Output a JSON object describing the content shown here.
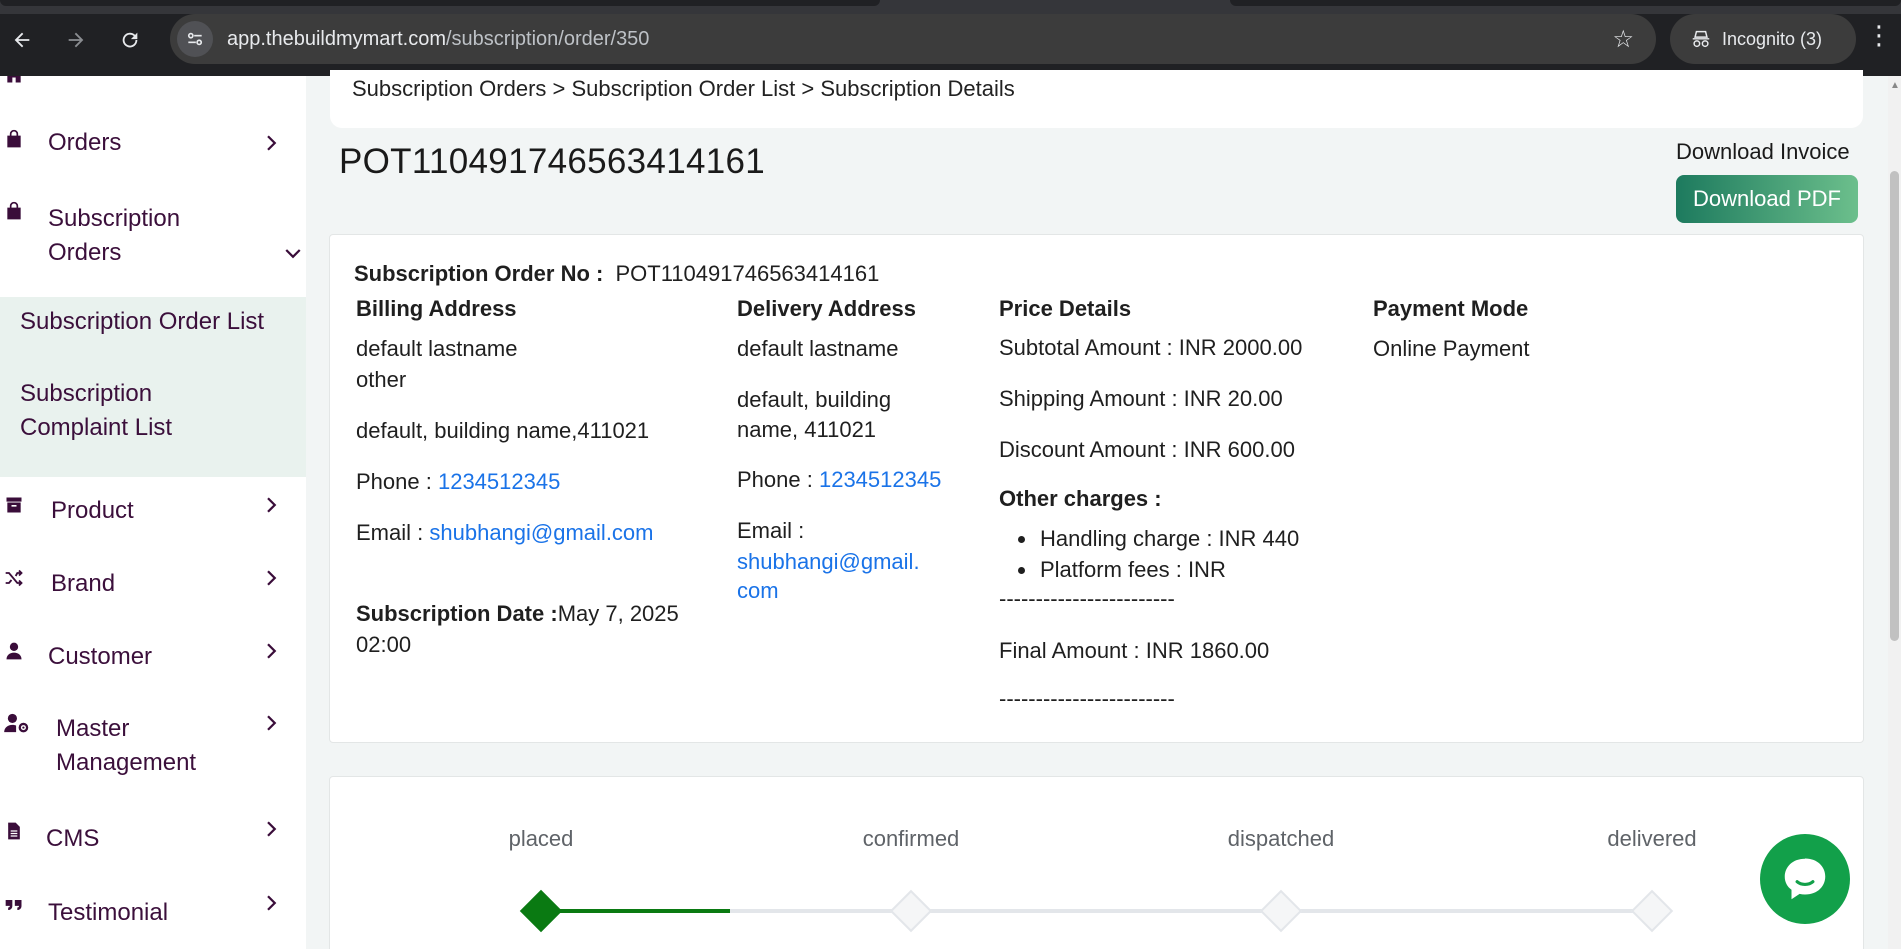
{
  "browser": {
    "url_host": "app.thebuildmymart.com",
    "url_path": "/subscription/order/350",
    "incognito_label": "Incognito (3)"
  },
  "sidebar": {
    "items": [
      {
        "label": "Orders",
        "icon": "bag-icon"
      },
      {
        "label": "Subscription Orders",
        "icon": "bag-icon"
      },
      {
        "label": "Product",
        "icon": "archive-icon"
      },
      {
        "label": "Brand",
        "icon": "shuffle-icon"
      },
      {
        "label": "Customer",
        "icon": "user-icon"
      },
      {
        "label": "Master Management",
        "icon": "user-gear-icon"
      },
      {
        "label": "CMS",
        "icon": "file-icon"
      },
      {
        "label": "Testimonial",
        "icon": "quote-icon"
      }
    ],
    "sub_items": [
      {
        "label": "Subscription Order List"
      },
      {
        "label": "Subscription Complaint List"
      }
    ]
  },
  "breadcrumb": {
    "text": "Subscription Orders > Subscription Order List > Subscription Details"
  },
  "order": {
    "title": "POT110491746563414161",
    "download_invoice_label": "Download Invoice",
    "download_pdf_label": "Download PDF",
    "order_no_label": "Subscription Order No :",
    "order_no_value": "POT110491746563414161",
    "billing": {
      "heading": "Billing Address",
      "name": "default lastname",
      "type": "other",
      "address": "default, building name,411021",
      "phone_label": "Phone :",
      "phone": "1234512345",
      "email_label": "Email :",
      "email": "shubhangi@gmail.com"
    },
    "subscription_date_label": "Subscription Date :",
    "subscription_date_value": "May 7, 2025",
    "subscription_time_value": "02:00",
    "delivery": {
      "heading": "Delivery Address",
      "name": "default lastname",
      "address_line1": "default, building",
      "address_line2": "name, 411021",
      "phone_label": "Phone :",
      "phone": "1234512345",
      "email_label": "Email :",
      "email_line1": "shubhangi@gmail.",
      "email_line2": "com"
    },
    "price": {
      "heading": "Price Details",
      "subtotal": "Subtotal Amount : INR 2000.00",
      "shipping": "Shipping Amount : INR 20.00",
      "discount": "Discount Amount : INR 600.00",
      "other_charges_label": "Other charges :",
      "charges": [
        {
          "text": "Handling charge :  INR  440"
        },
        {
          "text": "Platform fees :  INR"
        }
      ],
      "separator": "------------------------",
      "final": "Final Amount : INR  1860.00"
    },
    "payment": {
      "heading": "Payment Mode",
      "mode": "Online Payment"
    }
  },
  "tracker": {
    "steps": [
      {
        "label": "placed",
        "completed": true
      },
      {
        "label": "confirmed",
        "completed": false
      },
      {
        "label": "dispatched",
        "completed": false
      },
      {
        "label": "delivered",
        "completed": false
      }
    ],
    "progress": 0.17,
    "active_color": "#0a7a12",
    "inactive_color": "#e3e6ea"
  },
  "colors": {
    "sidebar_text": "#3b0f3b",
    "submenu_bg": "#e9f2ee",
    "link": "#1a73e8",
    "download_btn_from": "#1d7a5e",
    "download_btn_to": "#6cbf8c",
    "chat_bg": "#12a04a"
  }
}
